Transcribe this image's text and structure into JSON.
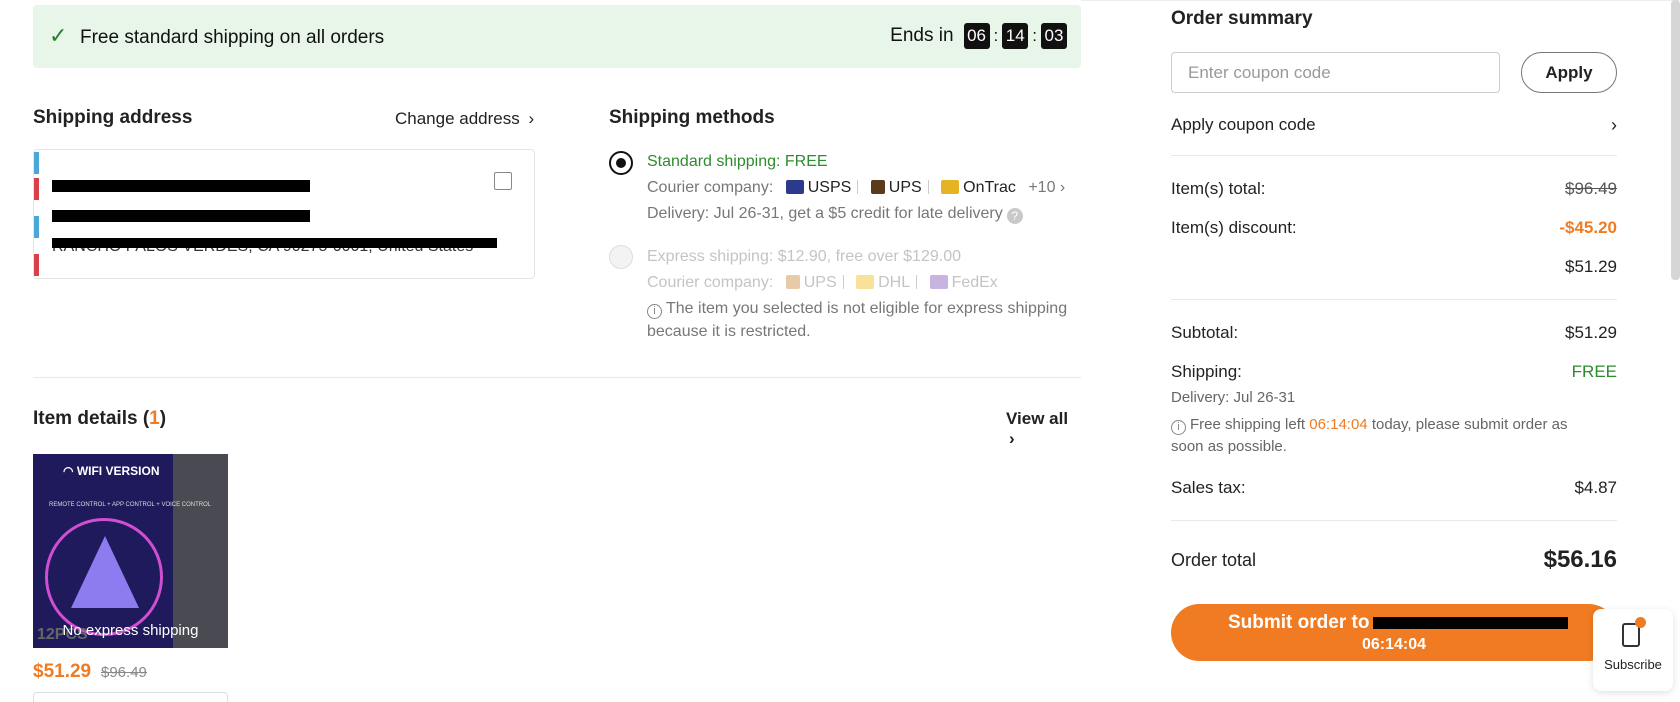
{
  "banner": {
    "message": "Free standard shipping on all orders",
    "ends_label": "Ends in",
    "timer": [
      "06",
      "14",
      "03"
    ]
  },
  "shipping_address": {
    "title": "Shipping address",
    "change_link": "Change address",
    "address_line": "RANCHO PALOS VERDES, CA 90275-0001, United States"
  },
  "shipping_methods": {
    "title": "Shipping methods",
    "standard": {
      "label": "Standard shipping: FREE",
      "courier_label": "Courier company:",
      "couriers": [
        "USPS",
        "UPS",
        "OnTrac"
      ],
      "more": "+10",
      "delivery": "Delivery: Jul 26-31, get a $5 credit for late delivery"
    },
    "express": {
      "label": "Express shipping: $12.90, free over $129.00",
      "courier_label": "Courier company:",
      "couriers": [
        "UPS",
        "DHL",
        "FedEx"
      ],
      "note_line1": "The item you selected is not eligible for express shipping",
      "note_line2": "because it is restricted."
    }
  },
  "item_details": {
    "title_prefix": "Item details (",
    "count": "1",
    "title_suffix": ")",
    "view_all": "View all",
    "product": {
      "badge_text": "WIFI VERSION",
      "image_caption": "REMOTE CONTROL + APP CONTROL + VOICE CONTROL",
      "pcs": "12PCS",
      "overlay": "No express shipping",
      "price": "$51.29",
      "original_price": "$96.49"
    }
  },
  "order_summary": {
    "title": "Order summary",
    "coupon_placeholder": "Enter coupon code",
    "apply_label": "Apply",
    "apply_coupon_link": "Apply coupon code",
    "items_total_label": "Item(s) total:",
    "items_total_value": "$96.49",
    "items_discount_label": "Item(s) discount:",
    "items_discount_value": "-$45.20",
    "after_discount_value": "$51.29",
    "subtotal_label": "Subtotal:",
    "subtotal_value": "$51.29",
    "shipping_label": "Shipping:",
    "shipping_value": "FREE",
    "delivery": "Delivery: Jul 26-31",
    "free_left_prefix": "Free shipping left",
    "free_left_time": "06:14:04",
    "free_left_suffix": "today, please submit order as",
    "free_left_line2": "soon as possible.",
    "sales_tax_label": "Sales tax:",
    "sales_tax_value": "$4.87",
    "order_total_label": "Order total",
    "order_total_value": "$56.16",
    "submit_label": "Submit order to",
    "submit_timer": "06:14:04"
  },
  "subscribe": {
    "label": "Subscribe"
  },
  "colors": {
    "accent_orange": "#f07b22",
    "free_green": "#2e8b2e",
    "banner_bg": "#e8f5e9"
  }
}
